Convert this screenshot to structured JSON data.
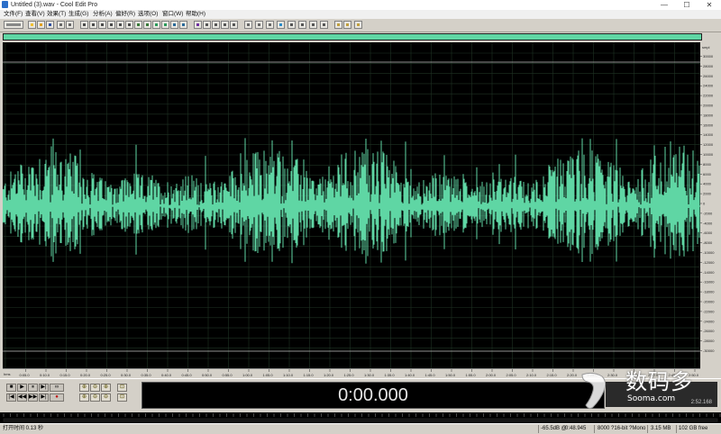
{
  "window": {
    "title": "Untitled (3).wav - Cool Edit Pro",
    "controls": [
      "—",
      "☐",
      "✕"
    ]
  },
  "menu": [
    "文件(F)",
    "查看(V)",
    "效果(T)",
    "生成(G)",
    "分析(A)",
    "偏好(R)",
    "选项(O)",
    "窗口(W)",
    "帮助(H)"
  ],
  "colors": {
    "waveform": "#5fd6a4",
    "wave_background": "#000000",
    "grid": "#1f3324",
    "chrome": "#d4d0c8",
    "time_text": "#e6e6e6"
  },
  "amplitude_ruler": {
    "unit": "smpl",
    "labels": [
      "30000",
      "28000",
      "26000",
      "24000",
      "22000",
      "20000",
      "18000",
      "16000",
      "14000",
      "12000",
      "10000",
      "8000",
      "6000",
      "4000",
      "2000",
      "0",
      "-2000",
      "-4000",
      "-6000",
      "-8000",
      "-10000",
      "-12000",
      "-14000",
      "-16000",
      "-18000",
      "-20000",
      "-22000",
      "-24000",
      "-26000",
      "-28000",
      "-30000"
    ]
  },
  "time_ruler": {
    "unit": "hms",
    "labels": [
      "0:05.0",
      "0:10.0",
      "0:15.0",
      "0:20.0",
      "0:25.0",
      "0:30.0",
      "0:35.0",
      "0:40.0",
      "0:45.0",
      "0:50.0",
      "0:55.0",
      "1:00.0",
      "1:05.0",
      "1:10.0",
      "1:15.0",
      "1:20.0",
      "1:25.0",
      "1:30.0",
      "1:35.0",
      "1:40.0",
      "1:45.0",
      "1:50.0",
      "1:55.0",
      "2:00.0",
      "2:05.0",
      "2:10.0",
      "2:15.0",
      "2:20.0",
      "2:25.0",
      "2:30.0",
      "2:35.0",
      "2:40.0",
      "2:45.0",
      "2:50.0",
      "2:55.0"
    ]
  },
  "transport": {
    "row1": [
      "■",
      "▶",
      "⏸",
      "▶|",
      "∞"
    ],
    "row2": [
      "|◀",
      "◀◀",
      "▶▶",
      "▶|",
      "●"
    ]
  },
  "zoom": {
    "row1": [
      "⊕",
      "⊖",
      "⊕",
      "⊡"
    ],
    "row2": [
      "⊕",
      "⊖",
      "⊖",
      "⊡"
    ]
  },
  "time_display": "0:00.000",
  "selection_readout": "2:52.168",
  "status": {
    "left": "打开时间 0.13 秒",
    "level": "-65.5dB @",
    "position": "0:48.945",
    "format": "8000 ?16-bit ?Mono",
    "size": "3.15 MB",
    "free": "102 GB free"
  },
  "watermark": {
    "text": "数码多",
    "url": "Sooma.com"
  }
}
